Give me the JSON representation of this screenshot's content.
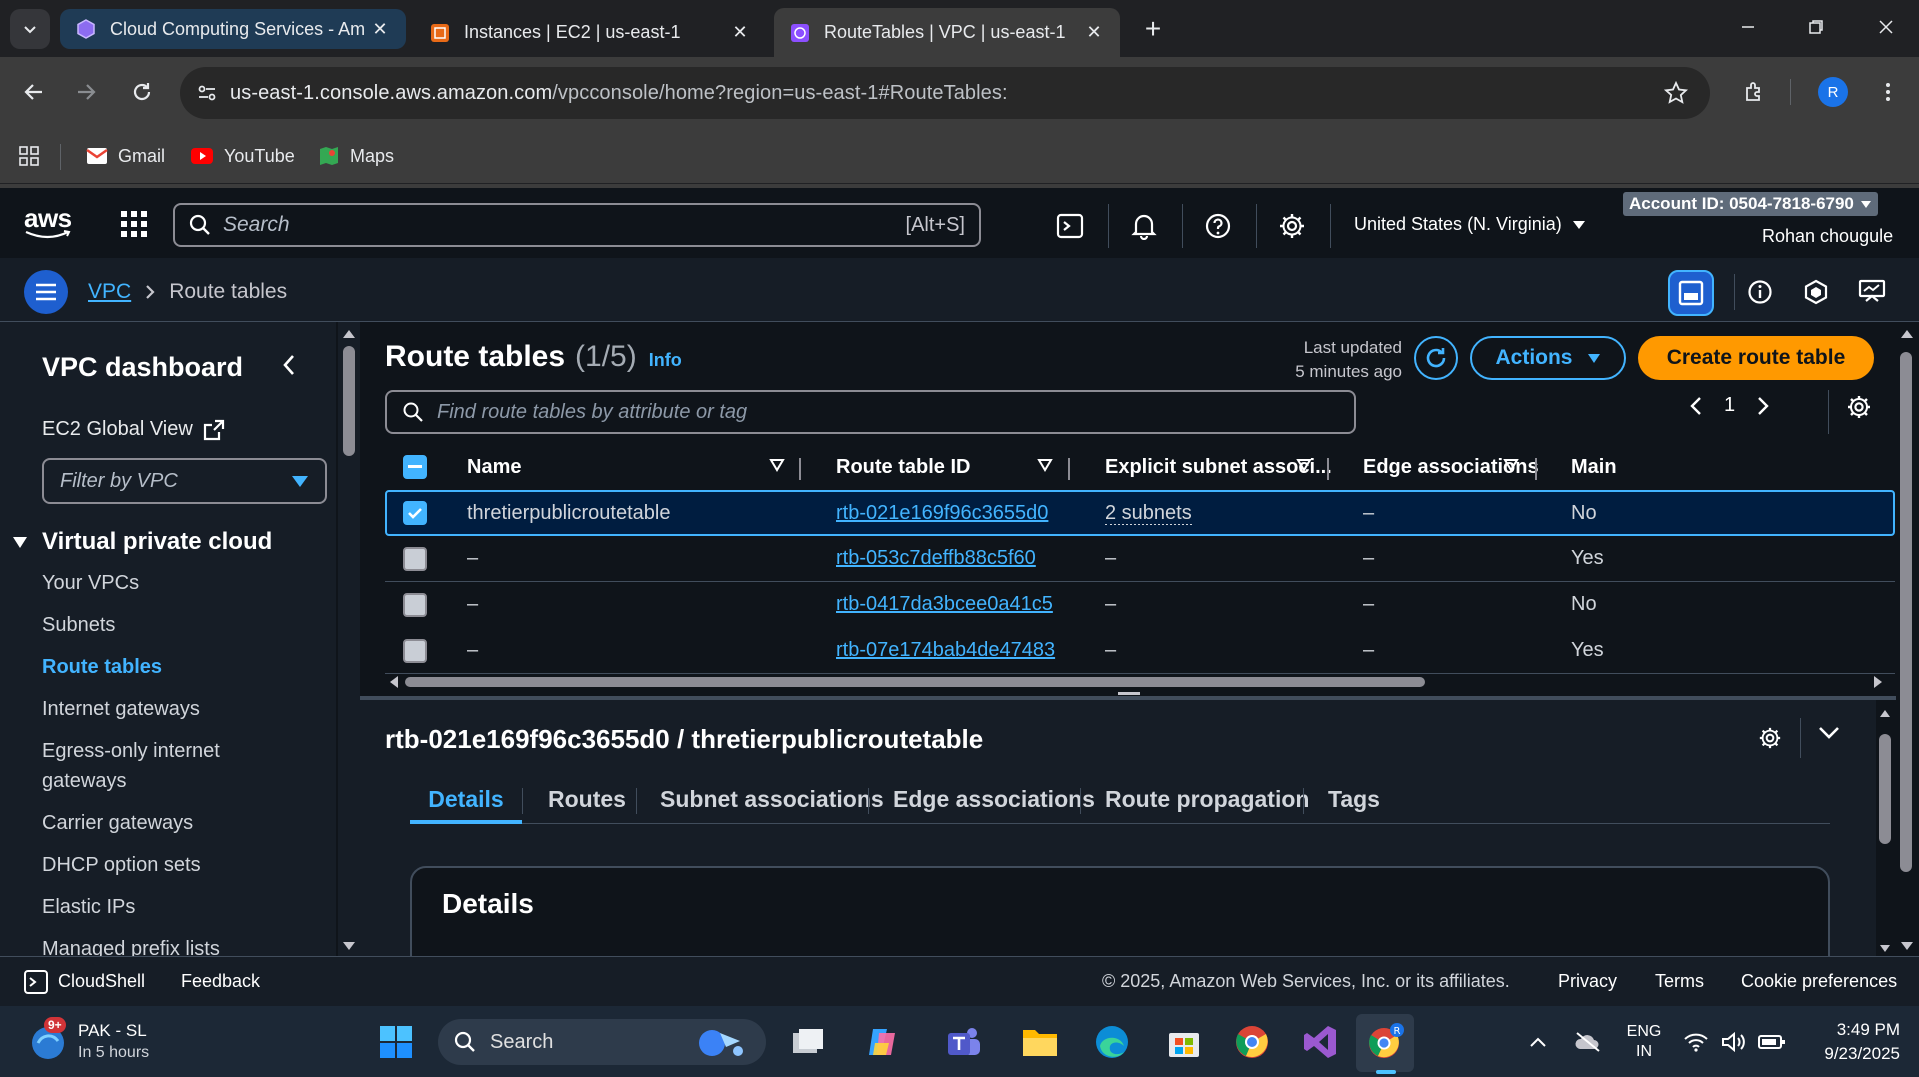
{
  "browser": {
    "tabs": [
      {
        "title": "Cloud Computing Services - Am"
      },
      {
        "title": "Instances | EC2 | us-east-1"
      },
      {
        "title": "RouteTables | VPC | us-east-1"
      }
    ],
    "url_host": "us-east-1.console.aws.amazon.com",
    "url_path": "/vpcconsole/home?region=us-east-1#RouteTables:",
    "profile_initial": "R",
    "bookmarks": [
      {
        "label": "Gmail",
        "icon": "gmail-icon"
      },
      {
        "label": "YouTube",
        "icon": "youtube-icon"
      },
      {
        "label": "Maps",
        "icon": "maps-icon"
      }
    ]
  },
  "aws_header": {
    "logo": "aws",
    "search_placeholder": "Search",
    "search_shortcut": "[Alt+S]",
    "region": "United States (N. Virginia)",
    "account_id": "Account ID: 0504-7818-6790",
    "user": "Rohan chougule"
  },
  "breadcrumb": {
    "root": "VPC",
    "current": "Route tables"
  },
  "sidebar": {
    "title": "VPC dashboard",
    "ec2_link": "EC2 Global View",
    "filter_placeholder": "Filter by VPC",
    "group": "Virtual private cloud",
    "items": [
      {
        "label": "Your VPCs"
      },
      {
        "label": "Subnets"
      },
      {
        "label": "Route tables",
        "active": true
      },
      {
        "label": "Internet gateways"
      },
      {
        "label": "Egress-only internet gateways"
      },
      {
        "label": "Carrier gateways"
      },
      {
        "label": "DHCP option sets"
      },
      {
        "label": "Elastic IPs"
      },
      {
        "label": "Managed prefix lists"
      }
    ]
  },
  "main": {
    "title": "Route tables",
    "count": "(1/5)",
    "info": "Info",
    "last_updated_label": "Last updated",
    "last_updated_value": "5 minutes ago",
    "actions_label": "Actions",
    "create_label": "Create route table",
    "search_placeholder": "Find route tables by attribute or tag",
    "page": "1",
    "columns": [
      "Name",
      "Route table ID",
      "Explicit subnet associ...",
      "Edge associations",
      "Main"
    ],
    "rows": [
      {
        "name": "thretierpublicroutetable",
        "id": "rtb-021e169f96c3655d0",
        "subnets": "2 subnets",
        "edge": "–",
        "main": "No",
        "selected": true
      },
      {
        "name": "–",
        "id": "rtb-053c7deffb88c5f60",
        "subnets": "–",
        "edge": "–",
        "main": "Yes",
        "selected": false
      },
      {
        "name": "–",
        "id": "rtb-0417da3bcee0a41c5",
        "subnets": "–",
        "edge": "–",
        "main": "No",
        "selected": false
      },
      {
        "name": "–",
        "id": "rtb-07e174bab4de47483",
        "subnets": "–",
        "edge": "–",
        "main": "Yes",
        "selected": false
      }
    ]
  },
  "detail": {
    "title": "rtb-021e169f96c3655d0 / thretierpublicroutetable",
    "tabs": [
      "Details",
      "Routes",
      "Subnet associations",
      "Edge associations",
      "Route propagation",
      "Tags"
    ],
    "active_tab": "Details",
    "card_title": "Details"
  },
  "footer": {
    "cloudshell": "CloudShell",
    "feedback": "Feedback",
    "copyright": "© 2025, Amazon Web Services, Inc. or its affiliates.",
    "privacy": "Privacy",
    "terms": "Terms",
    "cookies": "Cookie preferences"
  },
  "taskbar": {
    "weather_badge": "9+",
    "weather_title": "PAK - SL",
    "weather_sub": "In 5 hours",
    "search_placeholder": "Search",
    "lang_top": "ENG",
    "lang_bottom": "IN",
    "time": "3:49 PM",
    "date": "9/23/2025"
  },
  "colors": {
    "accent": "#42b4ff",
    "primary_button": "#ff9900",
    "background": "#0f141a"
  }
}
